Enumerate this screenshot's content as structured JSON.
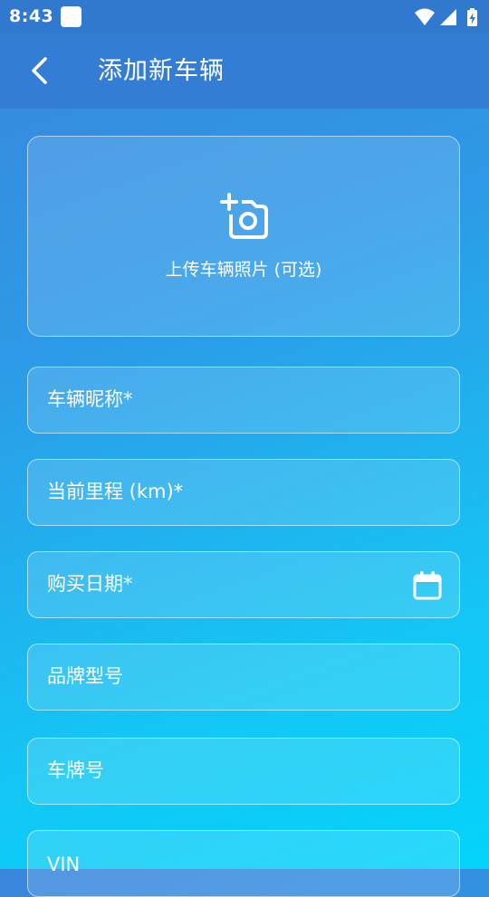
{
  "status_bar": {
    "time": "8:43",
    "icons": [
      "app-notification-icon",
      "wifi-icon",
      "cellular-signal-icon",
      "battery-charging-icon"
    ]
  },
  "app_bar": {
    "title": "添加新车辆",
    "back_icon": "back-arrow-icon"
  },
  "photo_upload": {
    "icon": "add-photo-icon",
    "label": "上传车辆照片 (可选)"
  },
  "form": {
    "fields": [
      {
        "label": "车辆昵称*"
      },
      {
        "label": "当前里程 (km)*"
      },
      {
        "label": "购买日期*",
        "icon": "calendar-icon"
      },
      {
        "label": "品牌型号"
      },
      {
        "label": "车牌号"
      },
      {
        "label": "VIN"
      }
    ]
  },
  "colors": {
    "gradient_top": "#3a86dc",
    "gradient_bottom": "#03d4fb",
    "status_bar": "#3178cf",
    "app_bar": "#337ed4",
    "text": "#ffffff"
  }
}
